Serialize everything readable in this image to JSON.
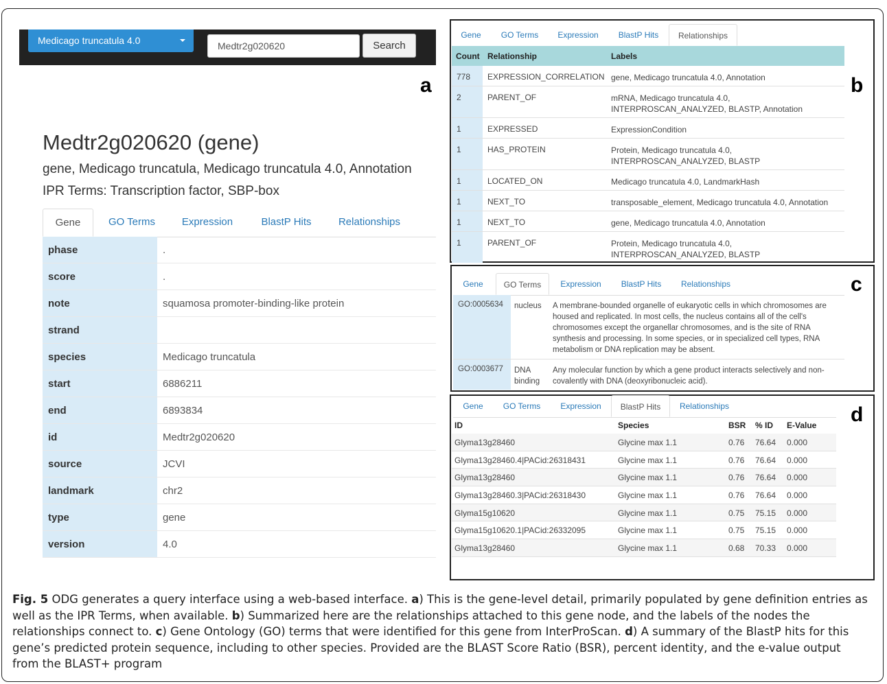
{
  "panel_letters": {
    "a": "a",
    "b": "b",
    "c": "c",
    "d": "d"
  },
  "panel_a": {
    "species_dropdown": "Medicago truncatula 4.0",
    "search": {
      "value": "Medtr2g020620",
      "button": "Search"
    },
    "title": "Medtr2g020620 (gene)",
    "labels": "gene, Medicago truncatula, Medicago truncatula 4.0, Annotation",
    "ipr": "IPR Terms: Transcription factor, SBP-box",
    "tabs": [
      "Gene",
      "GO Terms",
      "Expression",
      "BlastP Hits",
      "Relationships"
    ],
    "rows": [
      {
        "key": "phase",
        "value": "."
      },
      {
        "key": "score",
        "value": "."
      },
      {
        "key": "note",
        "value": "squamosa promoter-binding-like protein"
      },
      {
        "key": "strand",
        "value": ""
      },
      {
        "key": "species",
        "value": "Medicago truncatula"
      },
      {
        "key": "start",
        "value": "6886211"
      },
      {
        "key": "end",
        "value": "6893834"
      },
      {
        "key": "id",
        "value": "Medtr2g020620"
      },
      {
        "key": "source",
        "value": "JCVI"
      },
      {
        "key": "landmark",
        "value": "chr2"
      },
      {
        "key": "type",
        "value": "gene"
      },
      {
        "key": "version",
        "value": "4.0"
      }
    ]
  },
  "panel_b": {
    "tabs": [
      "Gene",
      "GO Terms",
      "Expression",
      "BlastP Hits",
      "Relationships"
    ],
    "headers": [
      "Count",
      "Relationship",
      "Labels"
    ],
    "rows": [
      {
        "count": "778",
        "rel": "EXPRESSION_CORRELATION",
        "labels": "gene, Medicago truncatula 4.0, Annotation"
      },
      {
        "count": "2",
        "rel": "PARENT_OF",
        "labels": "mRNA, Medicago truncatula 4.0, INTERPROSCAN_ANALYZED, BLASTP, Annotation"
      },
      {
        "count": "1",
        "rel": "EXPRESSED",
        "labels": "ExpressionCondition"
      },
      {
        "count": "1",
        "rel": "HAS_PROTEIN",
        "labels": "Protein, Medicago truncatula 4.0, INTERPROSCAN_ANALYZED, BLASTP"
      },
      {
        "count": "1",
        "rel": "LOCATED_ON",
        "labels": "Medicago truncatula 4.0, LandmarkHash"
      },
      {
        "count": "1",
        "rel": "NEXT_TO",
        "labels": "transposable_element, Medicago truncatula 4.0, Annotation"
      },
      {
        "count": "1",
        "rel": "NEXT_TO",
        "labels": "gene, Medicago truncatula 4.0, Annotation"
      },
      {
        "count": "1",
        "rel": "PARENT_OF",
        "labels": "Protein, Medicago truncatula 4.0, INTERPROSCAN_ANALYZED, BLASTP"
      }
    ]
  },
  "panel_c": {
    "tabs": [
      "Gene",
      "GO Terms",
      "Expression",
      "BlastP Hits",
      "Relationships"
    ],
    "rows": [
      {
        "id": "GO:0005634",
        "name": "nucleus",
        "def": "A membrane-bounded organelle of eukaryotic cells in which chromosomes are housed and replicated. In most cells, the nucleus contains all of the cell's chromosomes except the organellar chromosomes, and is the site of RNA synthesis and processing. In some species, or in specialized cell types, RNA metabolism or DNA replication may be absent."
      },
      {
        "id": "GO:0003677",
        "name": "DNA binding",
        "def": "Any molecular function by which a gene product interacts selectively and non-covalently with DNA (deoxyribonucleic acid)."
      }
    ]
  },
  "panel_d": {
    "tabs": [
      "Gene",
      "GO Terms",
      "Expression",
      "BlastP Hits",
      "Relationships"
    ],
    "headers": [
      "ID",
      "Species",
      "BSR",
      "% ID",
      "E-Value"
    ],
    "rows": [
      {
        "id": "Glyma13g28460",
        "species": "Glycine max 1.1",
        "bsr": "0.76",
        "pid": "76.64",
        "eval": "0.000"
      },
      {
        "id": "Glyma13g28460.4|PACid:26318431",
        "species": "Glycine max 1.1",
        "bsr": "0.76",
        "pid": "76.64",
        "eval": "0.000"
      },
      {
        "id": "Glyma13g28460",
        "species": "Glycine max 1.1",
        "bsr": "0.76",
        "pid": "76.64",
        "eval": "0.000"
      },
      {
        "id": "Glyma13g28460.3|PACid:26318430",
        "species": "Glycine max 1.1",
        "bsr": "0.76",
        "pid": "76.64",
        "eval": "0.000"
      },
      {
        "id": "Glyma15g10620",
        "species": "Glycine max 1.1",
        "bsr": "0.75",
        "pid": "75.15",
        "eval": "0.000"
      },
      {
        "id": "Glyma15g10620.1|PACid:26332095",
        "species": "Glycine max 1.1",
        "bsr": "0.75",
        "pid": "75.15",
        "eval": "0.000"
      },
      {
        "id": "Glyma13g28460",
        "species": "Glycine max 1.1",
        "bsr": "0.68",
        "pid": "70.33",
        "eval": "0.000"
      }
    ]
  },
  "caption": {
    "fig": "Fig. 5",
    "intro": " ODG generates a query interface using a web-based interface. ",
    "a": "a",
    "a_text": ") This is the gene-level detail, primarily populated by gene definition entries as well as the IPR Terms, when available. ",
    "b": "b",
    "b_text": ") Summarized here are the relationships attached to this gene node, and the labels of the nodes the relationships connect to. ",
    "c": "c",
    "c_text": ") Gene Ontology (GO) terms that were identified for this gene from InterProScan. ",
    "d": "d",
    "d_text": ") A summary of the BlastP hits for this gene’s predicted protein sequence, including to other species. Provided are the BLAST Score Ratio (BSR), percent identity, and the e-value output from the BLAST+ program"
  }
}
